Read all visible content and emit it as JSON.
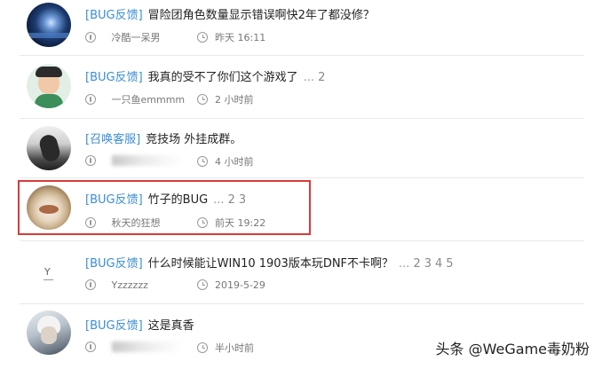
{
  "threads": [
    {
      "tag": "[BUG反馈]",
      "title": "冒险团角色数量显示错误啊快2年了都没修？",
      "pages_prefix": "",
      "pages": [],
      "author": "冷酷一呆男",
      "time": "昨天 16:11",
      "author_blurred": false
    },
    {
      "tag": "[BUG反馈]",
      "title": "我真的受不了你们这个游戏了",
      "pages_prefix": "...",
      "pages": [
        "2"
      ],
      "author": "一只鱼emmmm",
      "time": "2 小时前",
      "author_blurred": false
    },
    {
      "tag": "[召唤客服]",
      "title": "竞技场 外挂成群。",
      "pages_prefix": "",
      "pages": [],
      "author": "",
      "time": "4 小时前",
      "author_blurred": true
    },
    {
      "tag": "[BUG反馈]",
      "title": "竹子的BUG",
      "pages_prefix": "...",
      "pages": [
        "2",
        "3"
      ],
      "author": "秋天的狂想",
      "time": "前天 19:22",
      "author_blurred": false
    },
    {
      "tag": "[BUG反馈]",
      "title": "什么时候能让WIN10 1903版本玩DNF不卡啊？",
      "pages_prefix": "...",
      "pages": [
        "2",
        "3",
        "4",
        "5"
      ],
      "author": "Yzzzzzz",
      "time": "2019-5-29",
      "author_blurred": false
    },
    {
      "tag": "[BUG反馈]",
      "title": "这是真香",
      "pages_prefix": "",
      "pages": [],
      "author": "",
      "time": "半小时前",
      "author_blurred": true
    }
  ],
  "avatar_placeholder_letter": "Y",
  "watermark": "头条 @WeGame毒奶粉"
}
